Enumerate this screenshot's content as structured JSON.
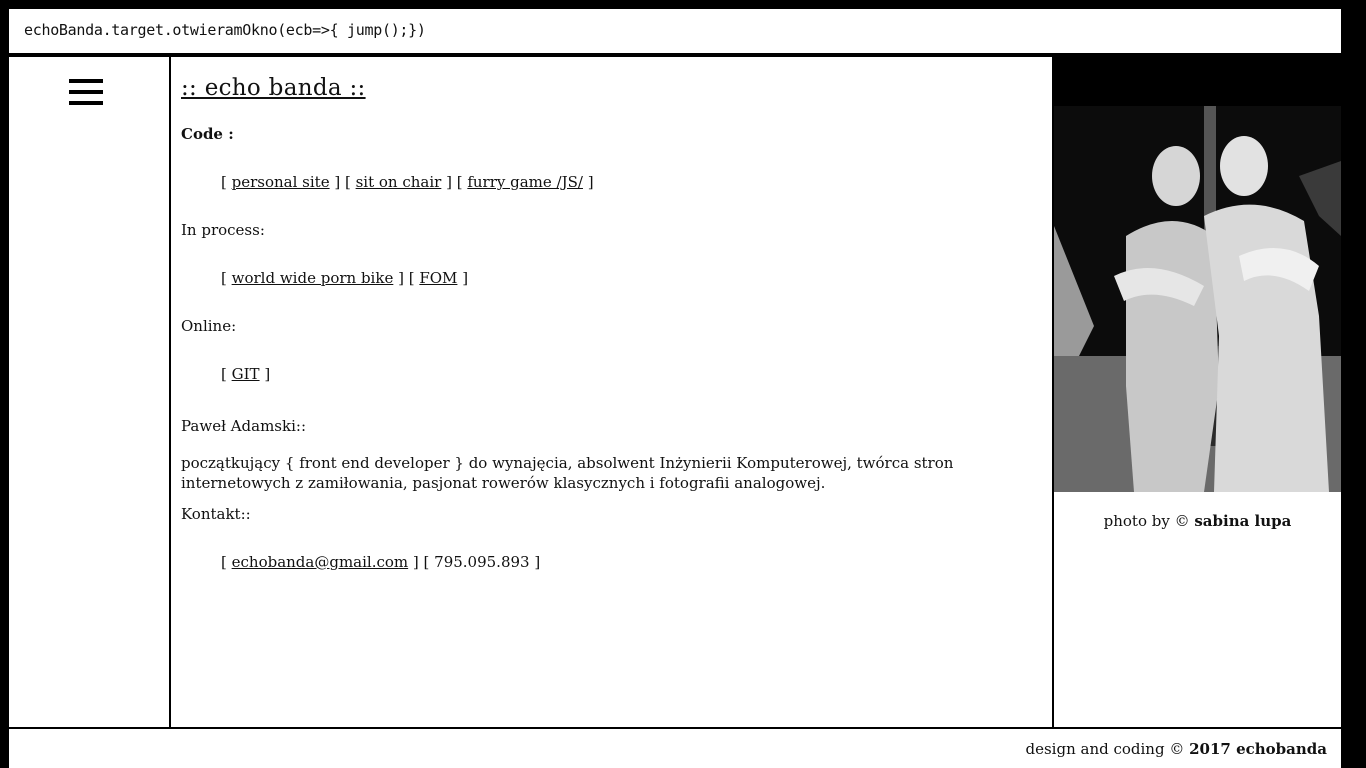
{
  "header": {
    "title": "echoBanda.target.otwieramOkno(ecb=>{ jump();})"
  },
  "main": {
    "heading": ":: echo banda ::",
    "code_label": "Code :",
    "code_links": [
      "personal site",
      "sit on chair",
      "furry game /JS/"
    ],
    "process_label": "In process:",
    "process_links": [
      "world wide porn bike",
      "FOM"
    ],
    "online_label": "Online:",
    "online_links": [
      "GIT"
    ],
    "person_label": "Paweł Adamski::",
    "bio": "początkujący { front end developer } do wynajęcia, absolwent Inżynierii Komputerowej, twórca stron internetowych z zamiłowania, pasjonat rowerów klasycznych i fotografii analogowej.",
    "contact_label": "Kontakt::",
    "contact_email": "echobanda@gmail.com",
    "contact_phone": "795.095.893"
  },
  "photo": {
    "caption_prefix": "photo by © ",
    "caption_author": "sabina lupa"
  },
  "footer": {
    "prefix": "design and coding © ",
    "year_brand": "2017 echobanda"
  },
  "colors": {
    "background": "#000000",
    "panel": "#ffffff",
    "text": "#111111"
  },
  "icons": {
    "menu": "hamburger-icon"
  }
}
